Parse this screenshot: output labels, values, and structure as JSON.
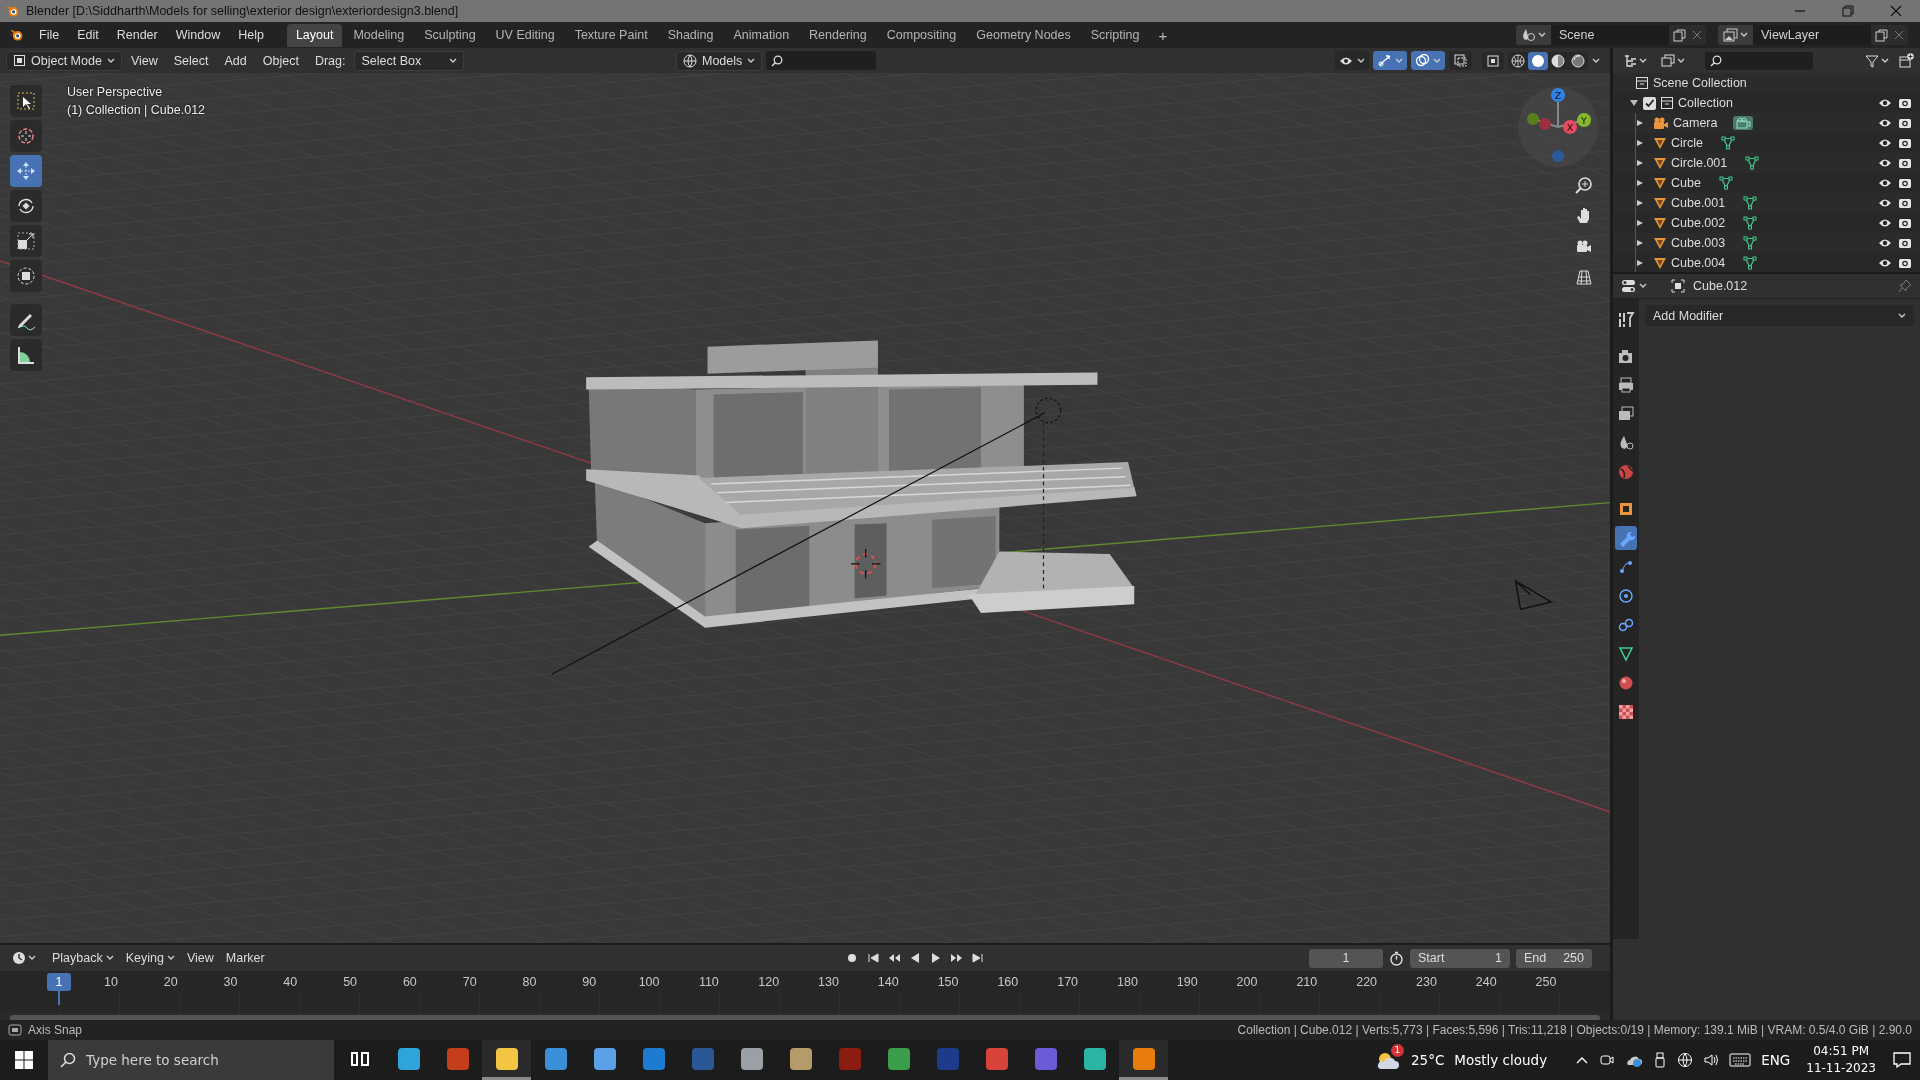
{
  "window": {
    "title": "Blender [D:\\Siddharth\\Models for selling\\exterior design\\exteriordesign3.blend]"
  },
  "menu": [
    "File",
    "Edit",
    "Render",
    "Window",
    "Help"
  ],
  "workspaces": [
    {
      "label": "Layout",
      "selected": true
    },
    {
      "label": "Modeling",
      "selected": false
    },
    {
      "label": "Sculpting",
      "selected": false
    },
    {
      "label": "UV Editing",
      "selected": false
    },
    {
      "label": "Texture Paint",
      "selected": false
    },
    {
      "label": "Shading",
      "selected": false
    },
    {
      "label": "Animation",
      "selected": false
    },
    {
      "label": "Rendering",
      "selected": false
    },
    {
      "label": "Compositing",
      "selected": false
    },
    {
      "label": "Geometry Nodes",
      "selected": false
    },
    {
      "label": "Scripting",
      "selected": false
    }
  ],
  "add_workspace": "+",
  "scene": "Scene",
  "view_layer": "ViewLayer",
  "viewport_header": {
    "mode": "Object Mode",
    "menus": [
      "View",
      "Select",
      "Add",
      "Object"
    ],
    "drag_label": "Drag:",
    "drag_value": "Select Box",
    "orientation": "Models",
    "toggles": [
      {
        "kind": "gizmo",
        "on": true
      },
      {
        "kind": "overlay",
        "on": true
      },
      {
        "kind": "xray",
        "on": false
      }
    ],
    "shading_modes": [
      {
        "kind": "wireframe",
        "selected": false
      },
      {
        "kind": "solid",
        "selected": true
      },
      {
        "kind": "material",
        "selected": false
      },
      {
        "kind": "rendered",
        "selected": false
      }
    ]
  },
  "viewport": {
    "info": [
      "User Perspective",
      "(1) Collection | Cube.012"
    ],
    "tools": [
      {
        "kind": "select",
        "selected": false
      },
      {
        "kind": "cursor",
        "selected": false
      },
      {
        "kind": "move",
        "selected": true
      },
      {
        "kind": "rotate",
        "selected": false
      },
      {
        "kind": "scale",
        "selected": false
      },
      {
        "kind": "transform",
        "selected": false
      },
      {
        "kind": "annotate",
        "selected": false
      },
      {
        "kind": "measure",
        "selected": false
      }
    ],
    "gizmo_axes": [
      "Z",
      "Y",
      "X"
    ]
  },
  "outliner": {
    "root": "Scene Collection",
    "collections": [
      {
        "name": "Collection",
        "checked": true,
        "expanded": true,
        "children": [
          {
            "name": "Camera",
            "kind": "camera",
            "expanded": false
          },
          {
            "name": "Circle",
            "kind": "mesh",
            "expanded": false
          },
          {
            "name": "Circle.001",
            "kind": "mesh",
            "expanded": false
          },
          {
            "name": "Cube",
            "kind": "mesh",
            "expanded": false
          },
          {
            "name": "Cube.001",
            "kind": "mesh",
            "expanded": false
          },
          {
            "name": "Cube.002",
            "kind": "mesh",
            "expanded": false
          },
          {
            "name": "Cube.003",
            "kind": "mesh",
            "expanded": false
          },
          {
            "name": "Cube.004",
            "kind": "mesh",
            "expanded": false
          }
        ]
      }
    ]
  },
  "properties": {
    "object": "Cube.012",
    "add_modifier": "Add Modifier",
    "tabs": [
      {
        "kind": "tool",
        "selected": false
      },
      {
        "kind": "render",
        "selected": false
      },
      {
        "kind": "output",
        "selected": false
      },
      {
        "kind": "view_layer",
        "selected": false
      },
      {
        "kind": "scene",
        "selected": false
      },
      {
        "kind": "world",
        "selected": false
      },
      {
        "kind": "object",
        "selected": false
      },
      {
        "kind": "modifier",
        "selected": true
      },
      {
        "kind": "particles",
        "selected": false
      },
      {
        "kind": "physics",
        "selected": false
      },
      {
        "kind": "constraints",
        "selected": false
      },
      {
        "kind": "data",
        "selected": false
      },
      {
        "kind": "material",
        "selected": false
      },
      {
        "kind": "texture",
        "selected": false
      }
    ]
  },
  "timeline": {
    "menus": [
      "Playback",
      "Keying",
      "View",
      "Marker"
    ],
    "current_frame": "1",
    "start_label": "Start",
    "start": "1",
    "end_label": "End",
    "end": "250",
    "playhead": "1",
    "ruler": [
      "10",
      "20",
      "30",
      "40",
      "50",
      "60",
      "70",
      "80",
      "90",
      "100",
      "110",
      "120",
      "130",
      "140",
      "150",
      "160",
      "170",
      "180",
      "190",
      "200",
      "210",
      "220",
      "230",
      "240",
      "250"
    ]
  },
  "status_bar": {
    "hint": "Axis Snap",
    "stats": "Collection | Cube.012 | Verts:5,773 | Faces:5,596 | Tris:11,218 | Objects:0/19 | Memory: 139.1 MiB | VRAM: 0.5/4.0 GiB | 2.90.0"
  },
  "taskbar": {
    "search_placeholder": "Type here to search",
    "apps": [
      {
        "kind": "task_view",
        "color": "#ffffff",
        "selected": false
      },
      {
        "kind": "app",
        "color": "#2fa4d9",
        "selected": false
      },
      {
        "kind": "app",
        "color": "#c43e1c",
        "selected": false
      },
      {
        "kind": "app",
        "color": "#f4c542",
        "selected": true
      },
      {
        "kind": "app",
        "color": "#3b8fd9",
        "selected": false
      },
      {
        "kind": "app",
        "color": "#5aa0e6",
        "selected": false
      },
      {
        "kind": "app",
        "color": "#1f7ad1",
        "selected": false
      },
      {
        "kind": "app",
        "color": "#2b5797",
        "selected": false
      },
      {
        "kind": "app",
        "color": "#9aa0a6",
        "selected": false
      },
      {
        "kind": "app",
        "color": "#b59a6a",
        "selected": false
      },
      {
        "kind": "app",
        "color": "#8c1c12",
        "selected": false
      },
      {
        "kind": "app",
        "color": "#3a9d4a",
        "selected": false
      },
      {
        "kind": "app",
        "color": "#1e3a8a",
        "selected": false
      },
      {
        "kind": "app",
        "color": "#d9443a",
        "selected": false
      },
      {
        "kind": "app",
        "color": "#6b5bd6",
        "selected": false
      },
      {
        "kind": "app",
        "color": "#2bb3a3",
        "selected": false
      },
      {
        "kind": "app",
        "color": "#e87d0d",
        "selected": true
      }
    ],
    "weather_badge": "1",
    "temperature": "25°C",
    "weather": "Mostly cloudy",
    "language": "ENG",
    "time": "04:51 PM",
    "date": "11-11-2023"
  }
}
